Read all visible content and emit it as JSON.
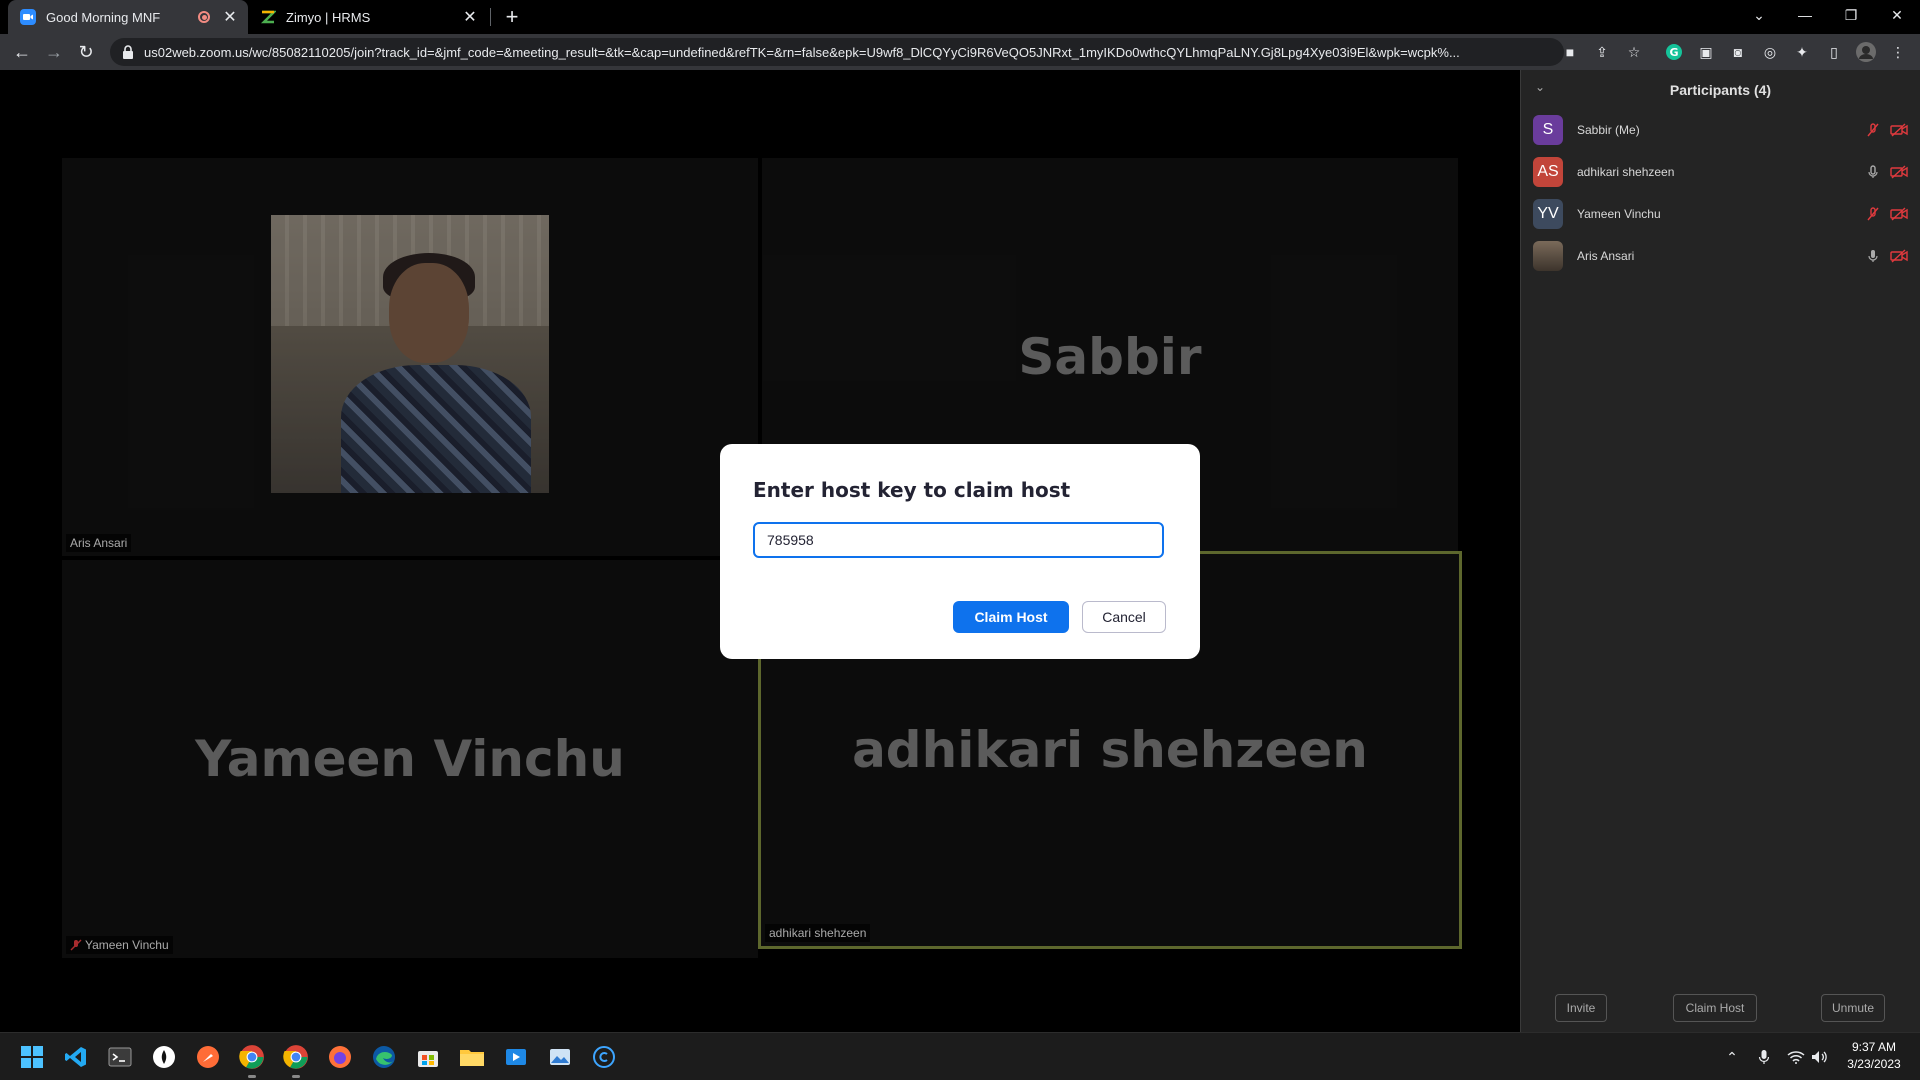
{
  "browser": {
    "tabs": [
      {
        "title": "Good Morning MNF",
        "icon": "zoom-icon",
        "recording": true,
        "active": true
      },
      {
        "title": "Zimyo | HRMS",
        "icon": "zimyo-icon",
        "active": false
      }
    ],
    "url": "us02web.zoom.us/wc/85082110205/join?track_id=&jmf_code=&meeting_result=&tk=&cap=undefined&refTK=&rn=false&epk=U9wf8_DlCQYyCi9R6VeQO5JNRxt_1myIKDo0wthcQYLhmqPaLNY.Gj8Lpg4Xye03i9El&wpk=wcpk%..."
  },
  "meeting": {
    "tiles": [
      {
        "id": "aris",
        "label": "Aris Ansari",
        "has_video": true
      },
      {
        "id": "sabbir",
        "label": "Sabbir",
        "big_name": "Sabbir"
      },
      {
        "id": "yameen",
        "label": "Yameen Vinchu",
        "big_name": "Yameen Vinchu",
        "muted": true
      },
      {
        "id": "adhikari",
        "label": "adhikari shehzeen",
        "big_name": "adhikari shehzeen",
        "active_speaker": true
      }
    ]
  },
  "dialog": {
    "title": "Enter host key to claim host",
    "host_key_value": "785958",
    "claim_label": "Claim Host",
    "cancel_label": "Cancel"
  },
  "participants": {
    "title": "Participants (4)",
    "items": [
      {
        "initials": "S",
        "name": "Sabbir (Me)",
        "avatar_color": "#6a3c9c",
        "mic": "muted",
        "video": "off"
      },
      {
        "initials": "AS",
        "name": "adhikari shehzeen",
        "avatar_color": "#c2453a",
        "mic": "on",
        "video": "off"
      },
      {
        "initials": "YV",
        "name": "Yameen Vinchu",
        "avatar_color": "#3d4a5e",
        "mic": "muted",
        "video": "off"
      },
      {
        "initials": "",
        "name": "Aris Ansari",
        "avatar_color": "#5a4b3f",
        "mic": "on",
        "video": "off"
      }
    ],
    "invite_label": "Invite",
    "claim_host_label": "Claim Host",
    "unmute_label": "Unmute"
  },
  "taskbar": {
    "time": "9:37 AM",
    "date": "3/23/2023"
  },
  "colors": {
    "zoom_blue": "#0e72ed",
    "speaker_border": "#7d8a3c",
    "muted_red": "#e03a3e"
  }
}
